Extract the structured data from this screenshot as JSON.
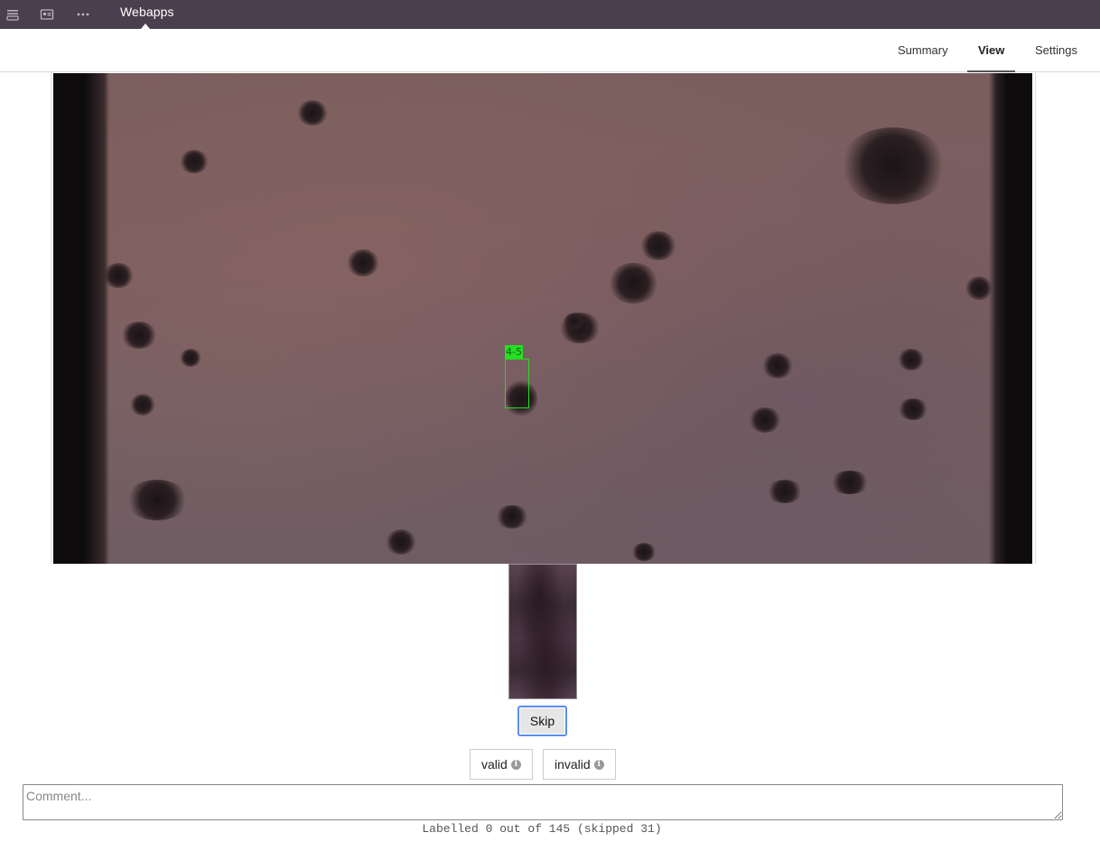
{
  "topbar": {
    "icons": [
      "layers-icon",
      "card-icon",
      "more-icon"
    ],
    "app_title": "Webapps"
  },
  "tabs": [
    {
      "label": "Summary",
      "active": false
    },
    {
      "label": "View",
      "active": true
    },
    {
      "label": "Settings",
      "active": false
    }
  ],
  "viewer": {
    "detection_label": "4-5",
    "detection_color": "#22dd22"
  },
  "actions": {
    "skip_label": "Skip",
    "valid_label": "valid",
    "invalid_label": "invalid",
    "info_glyph": "i"
  },
  "comment": {
    "placeholder": "Comment...",
    "value": ""
  },
  "status": {
    "text": "Labelled 0 out of 145 (skipped 31)"
  },
  "colors": {
    "topbar_bg": "#4a3f4e",
    "focus_outline": "#5b8ef0"
  }
}
